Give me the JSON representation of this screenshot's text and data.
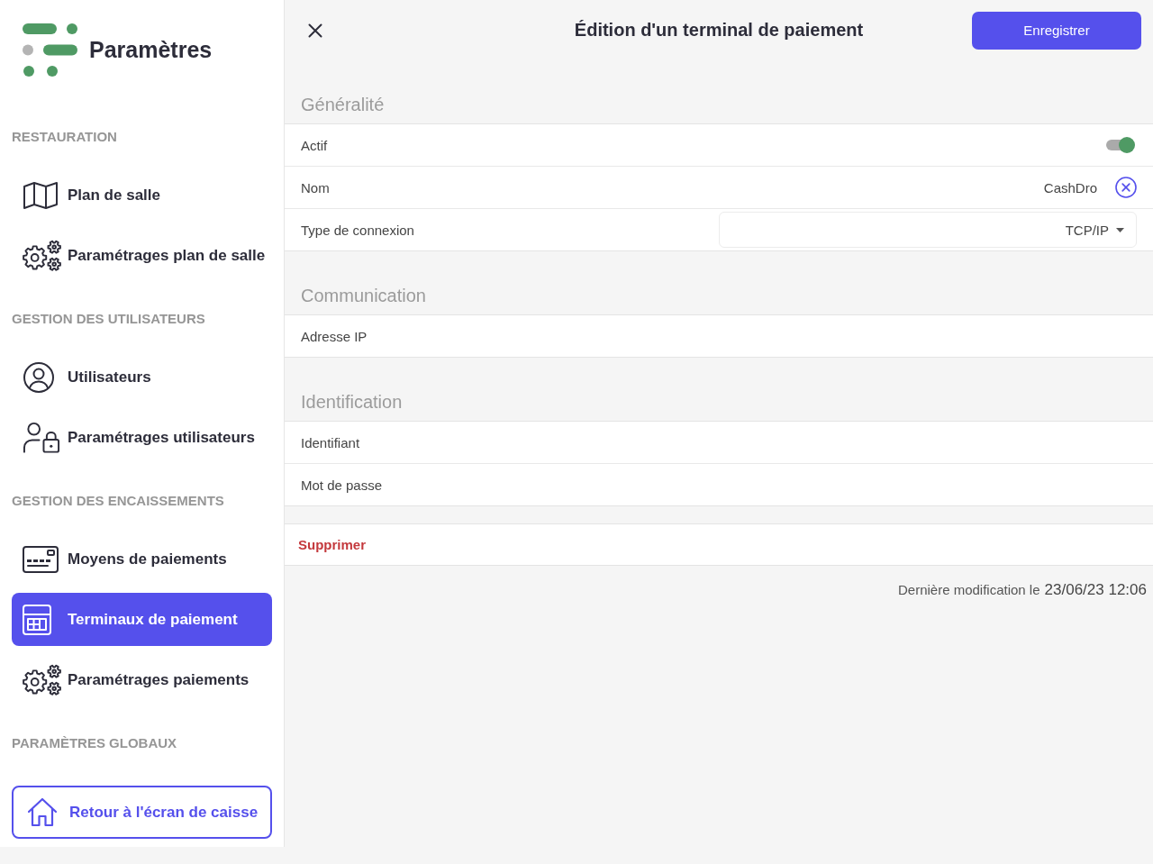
{
  "sidebar": {
    "title": "Paramètres",
    "sections": [
      {
        "heading": "RESTAURATION",
        "items": [
          {
            "label": "Plan de salle",
            "selected": false
          },
          {
            "label": "Paramétrages plan de salle",
            "selected": false
          }
        ]
      },
      {
        "heading": "GESTION DES UTILISATEURS",
        "items": [
          {
            "label": "Utilisateurs",
            "selected": false
          },
          {
            "label": "Paramétrages utilisateurs",
            "selected": false
          }
        ]
      },
      {
        "heading": "GESTION DES ENCAISSEMENTS",
        "items": [
          {
            "label": "Moyens de paiements",
            "selected": false
          },
          {
            "label": "Terminaux de paiement",
            "selected": true
          },
          {
            "label": "Paramétrages paiements",
            "selected": false
          }
        ]
      },
      {
        "heading": "PARAMÈTRES GLOBAUX"
      }
    ],
    "back_button": "Retour à l'écran de caisse"
  },
  "editor": {
    "title": "Édition d'un terminal de paiement",
    "save_button": "Enregistrer",
    "sections": [
      {
        "heading": "Généralité",
        "rows": [
          {
            "kind": "toggle",
            "label": "Actif",
            "on": true
          },
          {
            "kind": "text",
            "label": "Nom",
            "value": "CashDro"
          },
          {
            "kind": "select",
            "label": "Type de connexion",
            "value": "TCP/IP"
          }
        ]
      },
      {
        "heading": "Communication",
        "rows": [
          {
            "kind": "text",
            "label": "Adresse IP"
          }
        ]
      },
      {
        "heading": "Identification",
        "rows": [
          {
            "kind": "text",
            "label": "Identifiant"
          },
          {
            "kind": "text",
            "label": "Mot de passe"
          }
        ]
      }
    ],
    "delete_button": "Supprimer",
    "last_modified": {
      "label": "Dernière modification le",
      "date": "23/06/23 12:06"
    }
  }
}
